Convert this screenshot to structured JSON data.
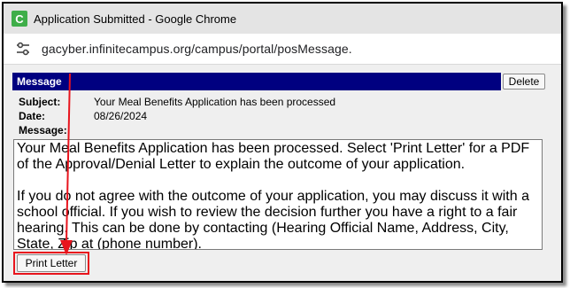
{
  "window": {
    "title": "Application Submitted - Google Chrome",
    "app_icon_letter": "C",
    "url": "gacyber.infinitecampus.org/campus/portal/posMessage."
  },
  "message": {
    "header": "Message",
    "delete_label": "Delete",
    "subject_label": "Subject:",
    "subject_value": "Your Meal Benefits Application has been processed",
    "date_label": "Date:",
    "date_value": "08/26/2024",
    "message_label": "Message:",
    "body_paragraph_1": "Your Meal Benefits Application has been processed.  Select 'Print Letter' for a PDF of the Approval/Denial Letter to explain the outcome of your application.",
    "body_paragraph_2": "If you do not agree with the outcome of your application, you may discuss it with a school official. If you wish to review the decision further you have a right to a fair hearing. This can be done by contacting (Hearing Official Name, Address, City, State, Zip at (phone number).",
    "print_label": "Print Letter"
  },
  "annotation": {
    "color": "#e8141d"
  }
}
